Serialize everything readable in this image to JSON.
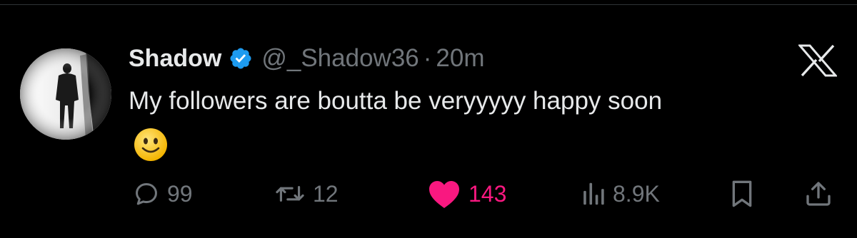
{
  "tweet": {
    "display_name": "Shadow",
    "handle": "@_Shadow36",
    "separator": "·",
    "time": "20m",
    "text": "My followers are boutta be veryyyyy happy soon",
    "emoji": "slightly-smiling-face-emoji",
    "verified": true,
    "platform_icon": "x-logo-icon"
  },
  "actions": {
    "replies": "99",
    "reposts": "12",
    "likes": "143",
    "views": "8.9K"
  },
  "colors": {
    "background": "#000000",
    "text": "#e7e9ea",
    "muted": "#71767b",
    "verified": "#1d9bf0",
    "like": "#f91880",
    "divider": "#2f3336"
  }
}
